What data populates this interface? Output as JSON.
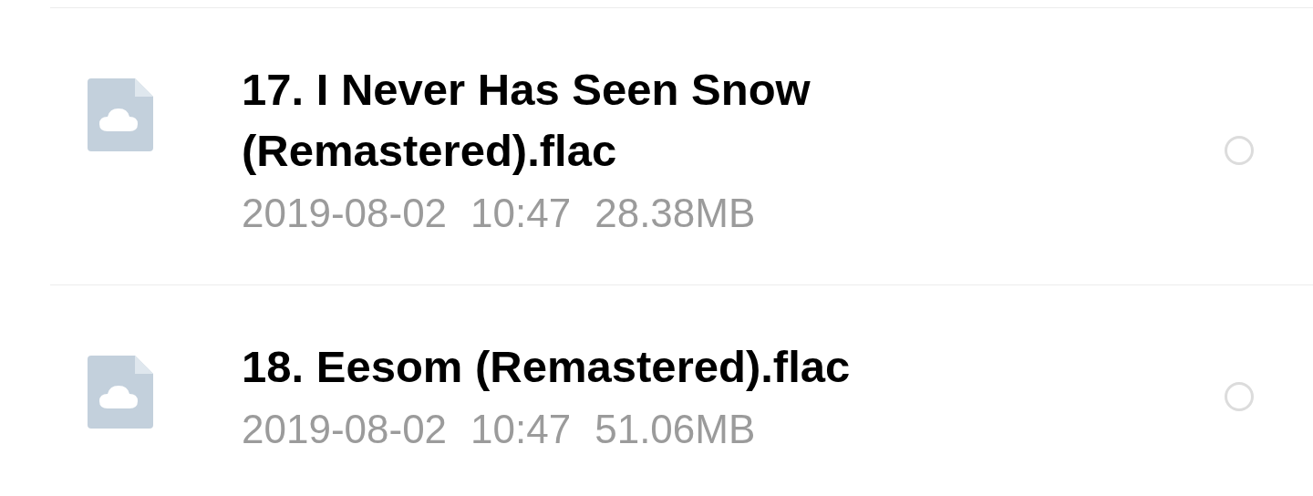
{
  "files": [
    {
      "name": "17. I Never Has Seen Snow (Remastered).flac",
      "date": "2019-08-02",
      "time": "10:47",
      "size": "28.38MB",
      "selected": false
    },
    {
      "name": "18. Eesom (Remastered).flac",
      "date": "2019-08-02",
      "time": "10:47",
      "size": "51.06MB",
      "selected": false
    }
  ]
}
